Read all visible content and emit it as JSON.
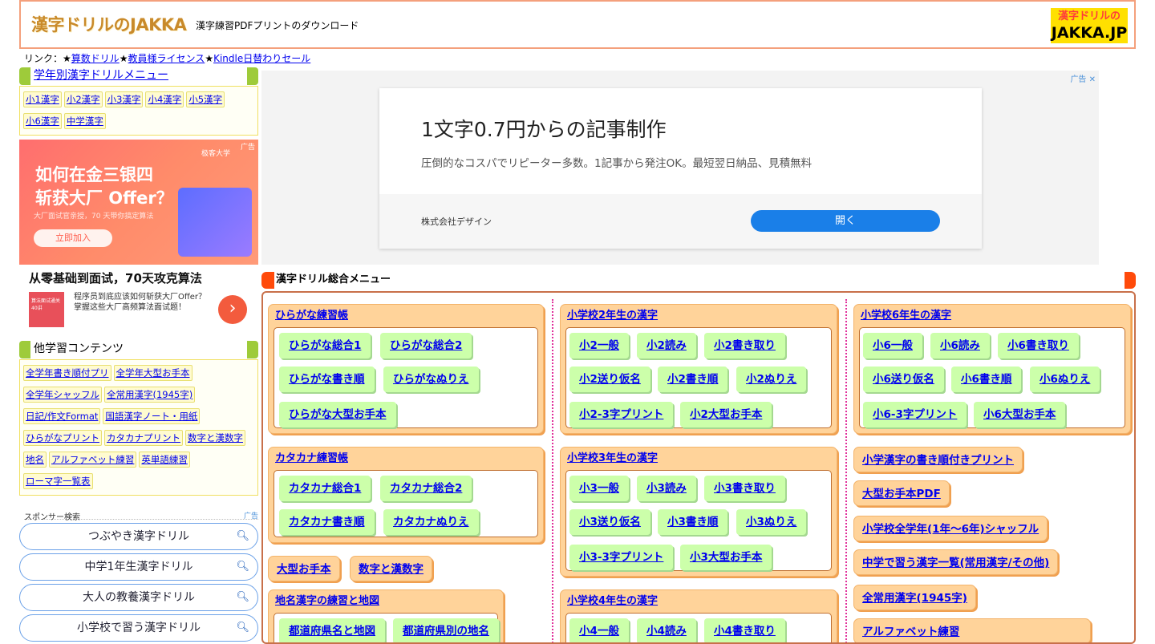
{
  "header": {
    "logo": "漢字ドリルのJAKKA",
    "subtitle": "漢字練習PDFプリントのダウンロード",
    "badge_line1": "漢字ドリルの",
    "badge_line2": "JAKKA.JP"
  },
  "links": {
    "prefix": "リンク：★",
    "items": [
      "算数ドリル",
      "教員様ライセンス",
      "Kindle日替わりセール"
    ],
    "sep": "★"
  },
  "grade_menu": {
    "title": "学年別漢字ドリルメニュー",
    "items": [
      "小1漢字",
      "小2漢字",
      "小3漢字",
      "小4漢字",
      "小5漢字",
      "小6漢字",
      "中学漢字"
    ]
  },
  "ad_left": {
    "tag": "广告",
    "logo": "极客大学",
    "headline1": "如何在金三银四",
    "headline2": "斩获大厂 Offer？",
    "subline": "大厂面试官亲授，70 天带你搞定算法",
    "button": "立即加入",
    "title": "从零基础到面试，70天攻克算法",
    "thumb": "算法面试通关40讲",
    "desc": "程序员到底应该如何斩获大厂Offer？掌握这些大厂高频算法面试题！",
    "go": "›"
  },
  "other_menu": {
    "title": "他学習コンテンツ",
    "items": [
      "全学年書き順付プリ",
      "全学年大型お手本",
      "全学年シャッフル",
      "全常用漢字(1945字)",
      "日記/作文Format",
      "国語漢字ノート・用紙",
      "ひらがなプリント",
      "カタカナプリント",
      "数字と漢数字",
      "地名",
      "アルファベット練習",
      "英単語練習",
      "ローマ字一覧表"
    ]
  },
  "sponsor": {
    "caption": "スポンサー検索",
    "ad_tag": "广告",
    "items": [
      "つぶやき漢字ドリル",
      "中学1年生漢字ドリル",
      "大人の教養漢字ドリル",
      "小学校で習う漢字ドリル"
    ]
  },
  "ad_main": {
    "tag": "广告 ✕",
    "title": "1文字0.7円からの記事制作",
    "text": "圧倒的なコスパでリピーター多数。1記事から発注OK。最短翌日納品、見積無料",
    "company": "株式会社デザイン",
    "button": "開く"
  },
  "menu": {
    "title": "漢字ドリル総合メニュー",
    "col1": {
      "hiragana": {
        "title": "ひらがな練習帳",
        "items": [
          "ひらがな総合1",
          "ひらがな総合2",
          "ひらがな書き順",
          "ひらがなぬりえ",
          "ひらがな大型お手本"
        ]
      },
      "katakana": {
        "title": "カタカナ練習帳",
        "items": [
          "カタカナ総合1",
          "カタカナ総合2",
          "カタカナ書き順",
          "カタカナぬりえ"
        ]
      },
      "singles": [
        "大型お手本",
        "数字と漢数字"
      ],
      "chimei": {
        "title": "地名漢字の練習と地図",
        "items": [
          "都道府県名と地図",
          "都道府県別の地名"
        ]
      }
    },
    "col2": {
      "g2": {
        "title": "小学校2年生の漢字",
        "items": [
          "小2一般",
          "小2読み",
          "小2書き取り",
          "小2送り仮名",
          "小2書き順",
          "小2ぬりえ",
          "小2-3字プリント",
          "小2大型お手本"
        ]
      },
      "g3": {
        "title": "小学校3年生の漢字",
        "items": [
          "小3一般",
          "小3読み",
          "小3書き取り",
          "小3送り仮名",
          "小3書き順",
          "小3ぬりえ",
          "小3-3字プリント",
          "小3大型お手本"
        ]
      },
      "g4": {
        "title": "小学校4年生の漢字",
        "items": [
          "小4一般",
          "小4読み",
          "小4書き取り"
        ]
      }
    },
    "col3": {
      "g6": {
        "title": "小学校6年生の漢字",
        "items": [
          "小6一般",
          "小6読み",
          "小6書き取り",
          "小6送り仮名",
          "小6書き順",
          "小6ぬりえ",
          "小6-3字プリント",
          "小6大型お手本"
        ]
      },
      "singles": [
        "小学漢字の書き順付きプリント",
        "大型お手本PDF",
        "小学校全学年(1年〜6年)シャッフル",
        "中学で習う漢字一覧(常用漢字/その他)",
        "全常用漢字(1945字)",
        "アルファベット練習"
      ]
    }
  }
}
